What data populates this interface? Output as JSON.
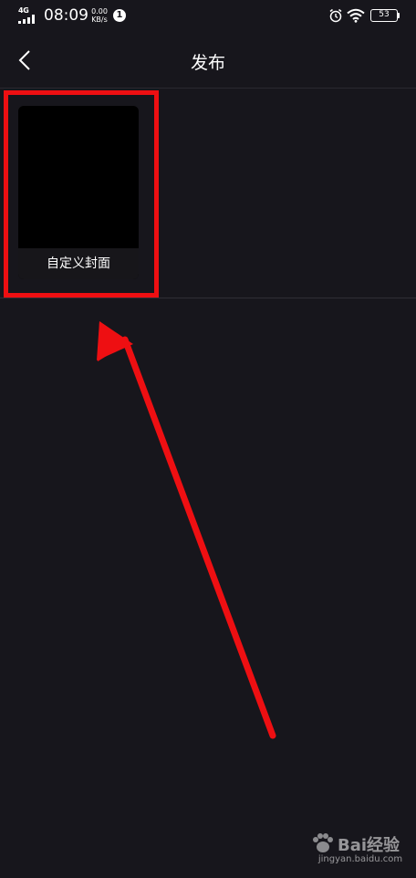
{
  "status_bar": {
    "network": "4G",
    "time": "08:09",
    "speed_value": "0.00",
    "speed_unit": "KB/s",
    "notification_count": "1",
    "battery": "53"
  },
  "header": {
    "title": "发布",
    "back_icon": "chevron-left-icon"
  },
  "cover": {
    "label": "自定义封面"
  },
  "watermark": {
    "brand": "Bai经验",
    "url": "jingyan.baidu.com"
  },
  "colors": {
    "background": "#17161c",
    "highlight": "#ee0f12",
    "text": "#ffffff"
  }
}
